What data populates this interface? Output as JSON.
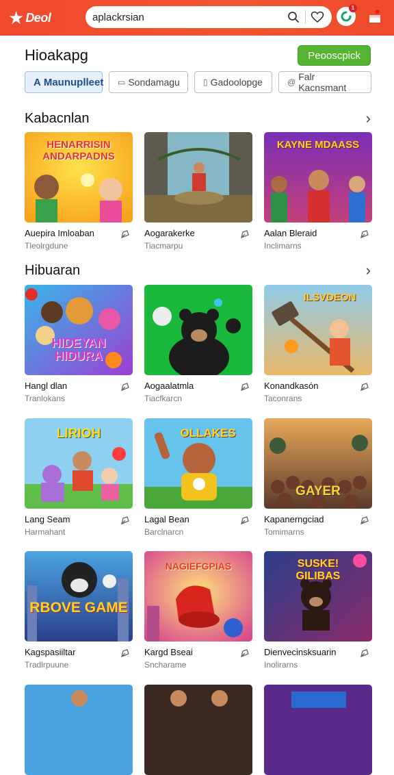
{
  "header": {
    "logo_text": "Deol",
    "search_value": "aplackrsian",
    "badge_count": "1"
  },
  "title": "Hioakapg",
  "cta_label": "Peooscpick",
  "chips": [
    {
      "label": "Maunuplleet",
      "prefix": "A",
      "active": true
    },
    {
      "label": "Sondamagu",
      "prefix": "",
      "active": false
    },
    {
      "label": "Gadoolopge",
      "prefix": "",
      "active": false
    },
    {
      "label": "Falr Kacnsmant",
      "prefix": "@",
      "active": false
    }
  ],
  "sections": [
    {
      "title": "Kabacnlan"
    },
    {
      "title": "Hibuaran"
    }
  ],
  "cards": [
    {
      "title": "Auepira Imloaban",
      "sub": "Tleolrgdune",
      "banner": "HENARRISIN ANDARPADNS"
    },
    {
      "title": "Aogarakerke",
      "sub": "Tiacmarpu",
      "banner": ""
    },
    {
      "title": "Aalan Bleraid",
      "sub": "Inclimarns",
      "banner": "KAYNE MDAASS"
    },
    {
      "title": "Hangl dlan",
      "sub": "Tranlokans",
      "banner": "HIDEYAN HIDURA"
    },
    {
      "title": "Aogaalatmla",
      "sub": "Tiacfkarcn",
      "banner": ""
    },
    {
      "title": "Konandkasón",
      "sub": "Taconrans",
      "banner": "ILSVDEON"
    },
    {
      "title": "Lang Seam",
      "sub": "Harmahant",
      "banner": "LIRIOH"
    },
    {
      "title": "Lagal Bean",
      "sub": "Barclnarcn",
      "banner": "OLLAKES"
    },
    {
      "title": "Kapanerngciad",
      "sub": "Tomimarns",
      "banner": "GAYER"
    },
    {
      "title": "Kagspasiiltar",
      "sub": "Tradlrpuune",
      "banner": "RBOVE GAME"
    },
    {
      "title": "Kargd Bseai",
      "sub": "Sncharame",
      "banner": "NAGIEFGPIAS"
    },
    {
      "title": "Dienvecinsksuarin",
      "sub": "Inolirarns",
      "banner": "SUSKE! GILIBAS"
    }
  ],
  "colors": {
    "header": "#f0492e",
    "cta": "#55b531",
    "active_chip_bg": "#e6f0fb"
  }
}
